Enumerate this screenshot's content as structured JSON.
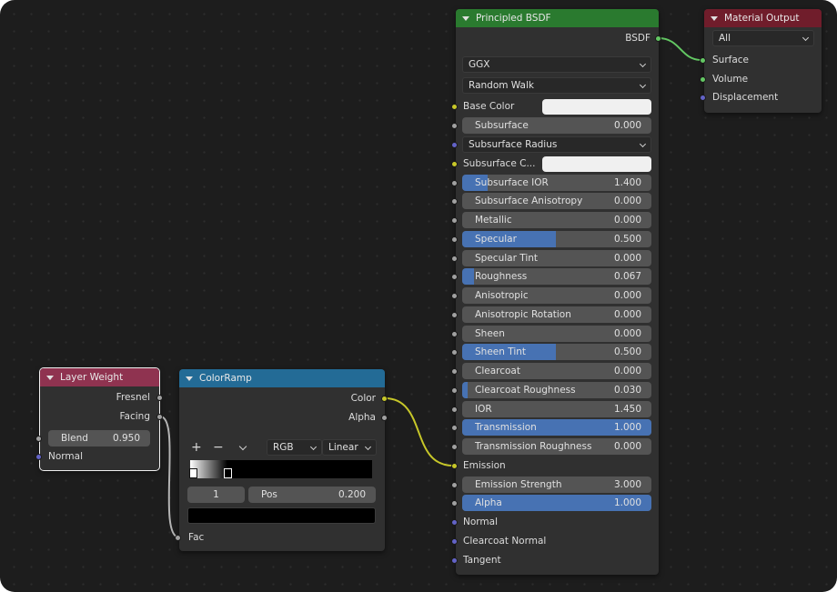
{
  "colors": {
    "shader_header": "#2a7a2f",
    "output_header": "#701d2b",
    "input_header": "#8f3350",
    "converter_header": "#236b96",
    "socket_shader": "#63c763",
    "socket_color": "#c7c729",
    "socket_vector": "#6363c7",
    "socket_float": "#a1a1a1",
    "slider_fill": "#4772b3"
  },
  "principled": {
    "title": "Principled BSDF",
    "output_label": "BSDF",
    "distribution": "GGX",
    "subsurface_method": "Random Walk",
    "base_color_label": "Base Color",
    "subsurface_label": "Subsurface",
    "subsurface_value": "0.000",
    "subsurface_radius": "Subsurface Radius",
    "subsurface_color_label": "Subsurface C...",
    "subsurface_ior_label": "Subsurface IOR",
    "subsurface_ior_value": "1.400",
    "subsurface_anisotropy_label": "Subsurface Anisotropy",
    "subsurface_anisotropy_value": "0.000",
    "metallic_label": "Metallic",
    "metallic_value": "0.000",
    "specular_label": "Specular",
    "specular_value": "0.500",
    "specular_tint_label": "Specular Tint",
    "specular_tint_value": "0.000",
    "roughness_label": "Roughness",
    "roughness_value": "0.067",
    "anisotropic_label": "Anisotropic",
    "anisotropic_value": "0.000",
    "anisotropic_rotation_label": "Anisotropic Rotation",
    "anisotropic_rotation_value": "0.000",
    "sheen_label": "Sheen",
    "sheen_value": "0.000",
    "sheen_tint_label": "Sheen Tint",
    "sheen_tint_value": "0.500",
    "clearcoat_label": "Clearcoat",
    "clearcoat_value": "0.000",
    "clearcoat_roughness_label": "Clearcoat Roughness",
    "clearcoat_roughness_value": "0.030",
    "ior_label": "IOR",
    "ior_value": "1.450",
    "transmission_label": "Transmission",
    "transmission_value": "1.000",
    "transmission_roughness_label": "Transmission Roughness",
    "transmission_roughness_value": "0.000",
    "emission_label": "Emission",
    "emission_strength_label": "Emission Strength",
    "emission_strength_value": "3.000",
    "alpha_label": "Alpha",
    "alpha_value": "1.000",
    "normal_label": "Normal",
    "clearcoat_normal_label": "Clearcoat Normal",
    "tangent_label": "Tangent"
  },
  "output": {
    "title": "Material Output",
    "target": "All",
    "surface_label": "Surface",
    "volume_label": "Volume",
    "displacement_label": "Displacement"
  },
  "layer_weight": {
    "title": "Layer Weight",
    "fresnel_label": "Fresnel",
    "facing_label": "Facing",
    "blend_label": "Blend",
    "blend_value": "0.950",
    "normal_label": "Normal"
  },
  "colorramp": {
    "title": "ColorRamp",
    "color_label": "Color",
    "alpha_label": "Alpha",
    "add_icon": "+",
    "remove_icon": "−",
    "color_mode": "RGB",
    "interpolation": "Linear",
    "active_index": "1",
    "pos_label": "Pos",
    "pos_value": "0.200",
    "fac_label": "Fac"
  }
}
